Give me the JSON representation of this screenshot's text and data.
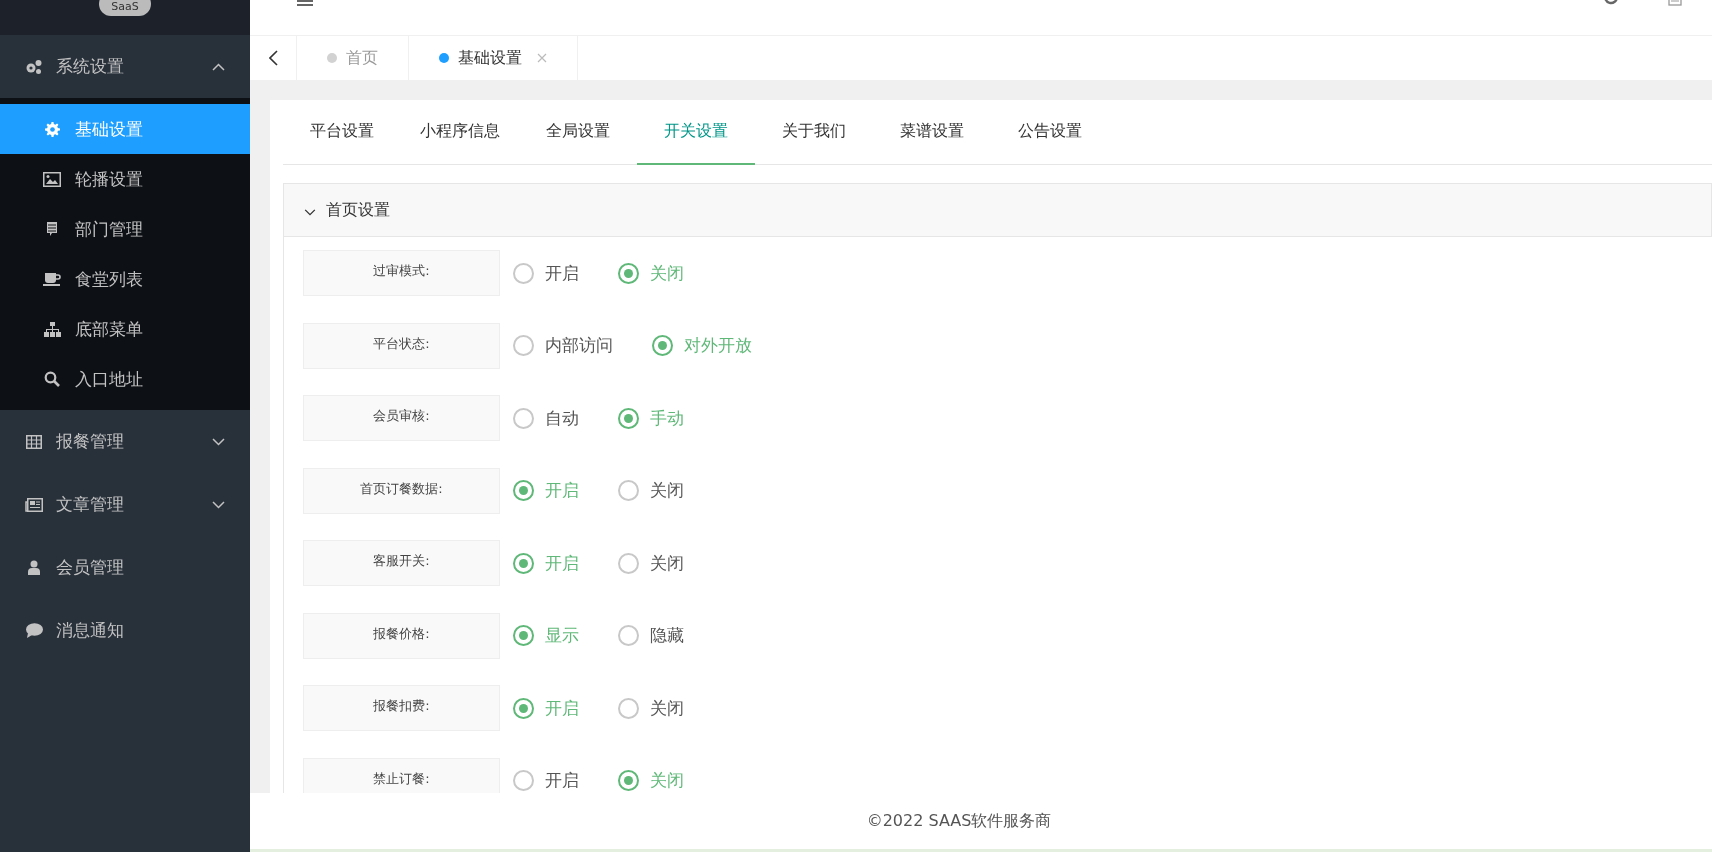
{
  "logo": {
    "badge": "SaaS"
  },
  "sidebar": {
    "items": [
      {
        "label": "系统设置",
        "expanded": true,
        "children": [
          {
            "label": "基础设置",
            "selected": true
          },
          {
            "label": "轮播设置",
            "selected": false
          },
          {
            "label": "部门管理",
            "selected": false
          },
          {
            "label": "食堂列表",
            "selected": false
          },
          {
            "label": "底部菜单",
            "selected": false
          },
          {
            "label": "入口地址",
            "selected": false
          }
        ]
      },
      {
        "label": "报餐管理",
        "expanded": false
      },
      {
        "label": "文章管理",
        "expanded": false
      },
      {
        "label": "会员管理"
      },
      {
        "label": "消息通知"
      }
    ]
  },
  "page_tabs": [
    {
      "label": "首页",
      "selected": false,
      "closable": false
    },
    {
      "label": "基础设置",
      "selected": true,
      "closable": true
    }
  ],
  "settings_tabs": [
    {
      "label": "平台设置",
      "selected": false
    },
    {
      "label": "小程序信息",
      "selected": false
    },
    {
      "label": "全局设置",
      "selected": false
    },
    {
      "label": "开关设置",
      "selected": true
    },
    {
      "label": "关于我们",
      "selected": false
    },
    {
      "label": "菜谱设置",
      "selected": false
    },
    {
      "label": "公告设置",
      "selected": false
    }
  ],
  "section": {
    "title": "首页设置",
    "expanded": true,
    "rows": [
      {
        "label": "过审模式:",
        "options": [
          {
            "label": "开启",
            "selected": false
          },
          {
            "label": "关闭",
            "selected": true
          }
        ]
      },
      {
        "label": "平台状态:",
        "options": [
          {
            "label": "内部访问",
            "selected": false
          },
          {
            "label": "对外开放",
            "selected": true
          }
        ]
      },
      {
        "label": "会员审核:",
        "options": [
          {
            "label": "自动",
            "selected": false
          },
          {
            "label": "手动",
            "selected": true
          }
        ]
      },
      {
        "label": "首页订餐数据:",
        "options": [
          {
            "label": "开启",
            "selected": true
          },
          {
            "label": "关闭",
            "selected": false
          }
        ]
      },
      {
        "label": "客服开关:",
        "options": [
          {
            "label": "开启",
            "selected": true
          },
          {
            "label": "关闭",
            "selected": false
          }
        ]
      },
      {
        "label": "报餐价格:",
        "options": [
          {
            "label": "显示",
            "selected": true
          },
          {
            "label": "隐藏",
            "selected": false
          }
        ]
      },
      {
        "label": "报餐扣费:",
        "options": [
          {
            "label": "开启",
            "selected": true
          },
          {
            "label": "关闭",
            "selected": false
          }
        ]
      },
      {
        "label": "禁止订餐:",
        "options": [
          {
            "label": "开启",
            "selected": false
          },
          {
            "label": "关闭",
            "selected": true
          }
        ]
      }
    ]
  },
  "footer": {
    "text": "©2022 SAAS软件服务商"
  }
}
